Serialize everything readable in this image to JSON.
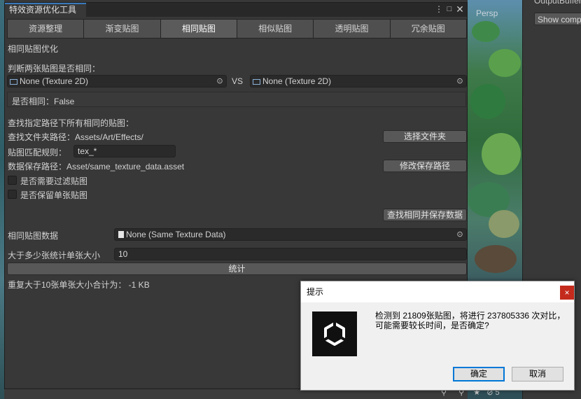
{
  "window": {
    "title": "特效资源优化工具",
    "menu_icon": "kebab-menu-icon",
    "maximize_icon": "maximize-icon",
    "close_icon": "close-icon"
  },
  "tabs": [
    {
      "label": "资源整理",
      "active": false
    },
    {
      "label": "渐变贴图",
      "active": false
    },
    {
      "label": "相同贴图",
      "active": true
    },
    {
      "label": "相似贴图",
      "active": false
    },
    {
      "label": "透明贴图",
      "active": false
    },
    {
      "label": "冗余贴图",
      "active": false
    }
  ],
  "section": {
    "title": "相同贴图优化",
    "compare_label": "判断两张贴图是否相同：",
    "texture_a": "None (Texture 2D)",
    "vs_label": "VS",
    "texture_b": "None (Texture 2D)",
    "result": "是否相同：False",
    "find_all_label": "查找指定路径下所有相同的贴图：",
    "folder_path": "查找文件夹路径：Assets/Art/Effects/",
    "select_folder_button": "选择文件夹",
    "match_rule_label": "贴图匹配规则：",
    "match_rule_value": "tex_*",
    "save_path": "数据保存路径：Asset/same_texture_data.asset",
    "change_save_path_button": "修改保存路径",
    "filter_checkbox_label": "是否需要过滤贴图",
    "keep_single_checkbox_label": "是否保留单张贴图",
    "find_and_save_button": "查找相同并保存数据",
    "data_label": "相同贴图数据",
    "data_value": "None (Same Texture Data)",
    "count_threshold_label": "大于多少张统计单张大小",
    "count_threshold_value": "10",
    "stats_button": "统计",
    "summary": "重复大于10张单张大小合计为：  -1 KB"
  },
  "background": {
    "scene_label": "Persp",
    "output_label": "OutputBuffer",
    "show_button": "Show comp",
    "scene_counter": "5"
  },
  "dialog": {
    "title": "提示",
    "close_icon": "close-icon",
    "logo": "unity-logo",
    "message_line1": "检测到 21809张贴图，将进行 237805336 次对比，",
    "message_line2": "可能需要较长时间，是否确定?",
    "ok_button": "确定",
    "cancel_button": "取消"
  },
  "colors": {
    "accent": "#3a79bb",
    "dialog_close": "#c42b1c",
    "dialog_default_border": "#0078d7"
  }
}
